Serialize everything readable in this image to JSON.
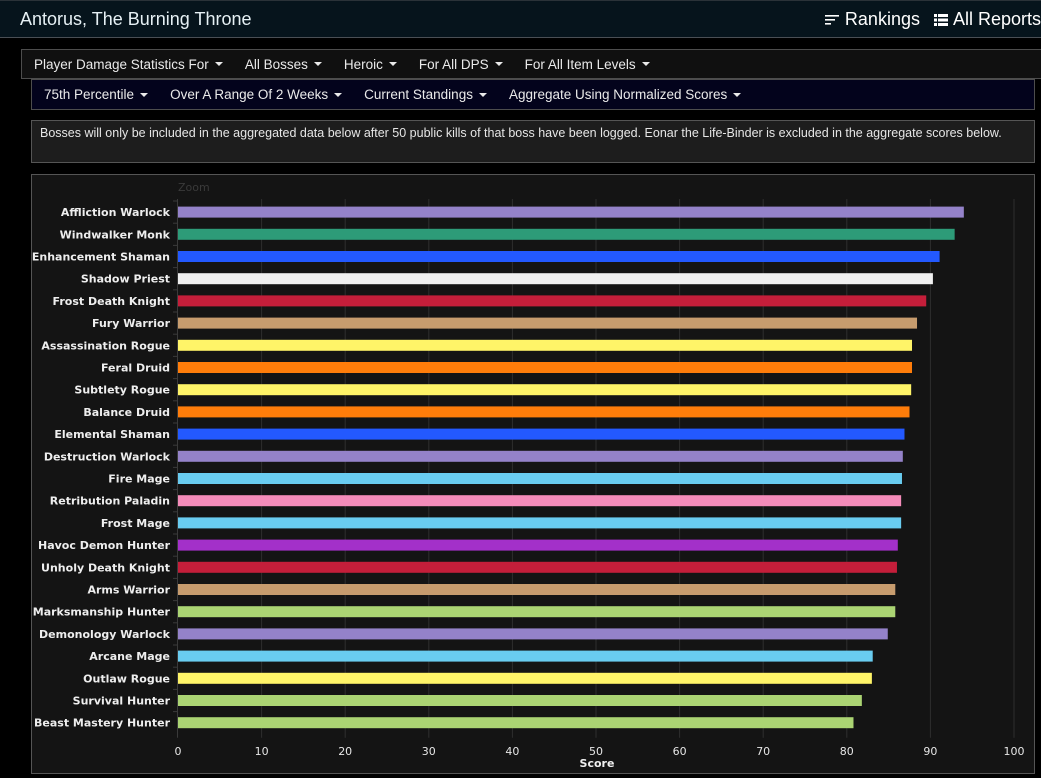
{
  "header": {
    "title": "Antorus, The Burning Throne",
    "nav": [
      {
        "label": "Rankings",
        "icon": "sort-lines-icon"
      },
      {
        "label": "All Reports",
        "icon": "list-icon"
      }
    ]
  },
  "filters_row1": [
    {
      "label": "Player Damage Statistics For"
    },
    {
      "label": "All Bosses"
    },
    {
      "label": "Heroic"
    },
    {
      "label": "For All DPS"
    },
    {
      "label": "For All Item Levels"
    }
  ],
  "filters_row2": [
    {
      "label": "75th Percentile"
    },
    {
      "label": "Over A Range Of 2 Weeks"
    },
    {
      "label": "Current Standings"
    },
    {
      "label": "Aggregate Using Normalized Scores"
    }
  ],
  "notice": "Bosses will only be included in the aggregated data below after 50 public kills of that boss have been logged. Eonar the Life-Binder is excluded in the aggregate scores below.",
  "chart_data": {
    "type": "bar",
    "orientation": "horizontal",
    "title": "",
    "zoom_label": "Zoom",
    "xlabel": "Score",
    "ylabel": "",
    "xlim": [
      0,
      100
    ],
    "xticks": [
      0,
      10,
      20,
      30,
      40,
      50,
      60,
      70,
      80,
      90,
      100
    ],
    "grid": true,
    "legend": "none",
    "categories": [
      "Affliction Warlock",
      "Windwalker Monk",
      "Enhancement Shaman",
      "Shadow Priest",
      "Frost Death Knight",
      "Fury Warrior",
      "Assassination Rogue",
      "Feral Druid",
      "Subtlety Rogue",
      "Balance Druid",
      "Elemental Shaman",
      "Destruction Warlock",
      "Fire Mage",
      "Retribution Paladin",
      "Frost Mage",
      "Havoc Demon Hunter",
      "Unholy Death Knight",
      "Arms Warrior",
      "Marksmanship Hunter",
      "Demonology Warlock",
      "Arcane Mage",
      "Outlaw Rogue",
      "Survival Hunter",
      "Beast Mastery Hunter"
    ],
    "values": [
      94.0,
      92.9,
      91.1,
      90.3,
      89.5,
      88.4,
      87.8,
      87.8,
      87.7,
      87.5,
      86.9,
      86.7,
      86.6,
      86.5,
      86.5,
      86.1,
      86.0,
      85.8,
      85.8,
      84.9,
      83.1,
      83.0,
      81.8,
      80.8
    ],
    "colors": [
      "#9482c9",
      "#2d9b78",
      "#2359ff",
      "#f0f0f0",
      "#c41e3a",
      "#c79c6e",
      "#fff468",
      "#ff7d0a",
      "#fff468",
      "#ff7d0a",
      "#2359ff",
      "#9482c9",
      "#69ccf0",
      "#f58cba",
      "#69ccf0",
      "#a330c9",
      "#c41e3a",
      "#c79c6e",
      "#abd473",
      "#9482c9",
      "#69ccf0",
      "#fff468",
      "#abd473",
      "#abd473"
    ]
  }
}
